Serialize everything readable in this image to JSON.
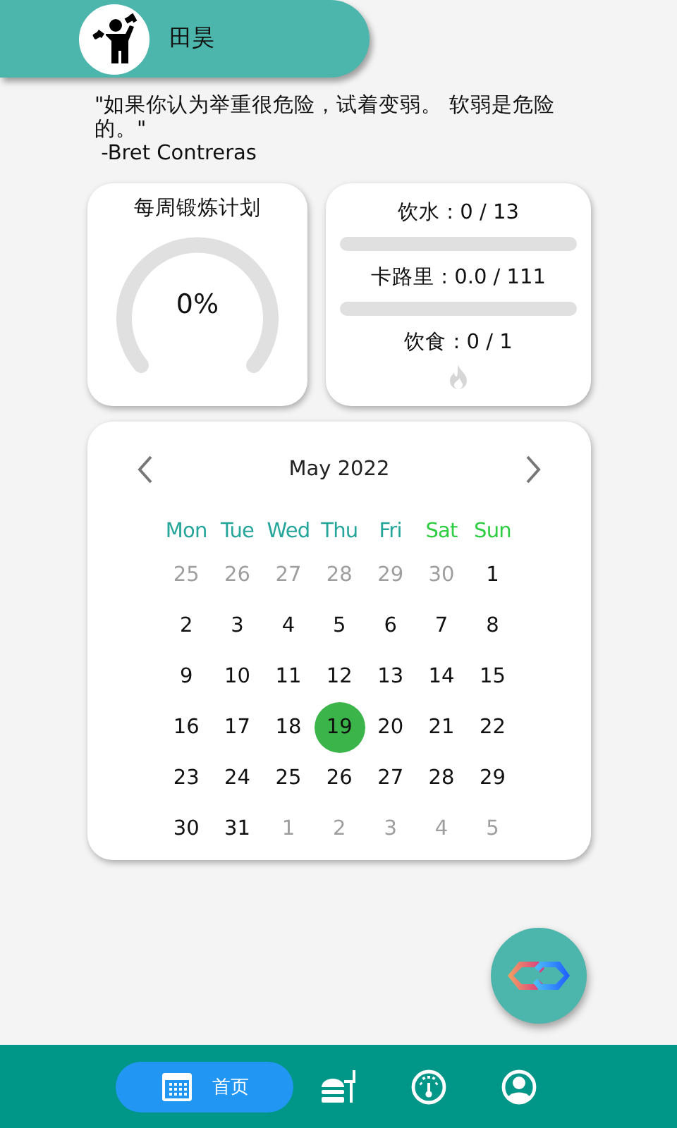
{
  "header": {
    "name": "田昊"
  },
  "quote": {
    "text": "\"如果你认为举重很危险，试着变弱。 软弱是危险的。\"",
    "author": " -Bret Contreras"
  },
  "weekly_plan": {
    "title": "每周锻炼计划",
    "reading": "0%"
  },
  "intake": [
    {
      "kind": "bar",
      "label": "饮水 : 0 / 13",
      "level": 0
    },
    {
      "kind": "bar",
      "label": "卡路里 : 0.0 / 111",
      "level": 0
    },
    {
      "kind": "flame",
      "label": "饮食 : 0 / 1"
    }
  ],
  "calendar": {
    "month": "May 2022",
    "weekdays": [
      {
        "label": "Mon",
        "color": "#26a69a"
      },
      {
        "label": "Tue",
        "color": "#26a69a"
      },
      {
        "label": "Wed",
        "color": "#26a69a"
      },
      {
        "label": "Thu",
        "color": "#26a69a"
      },
      {
        "label": "Fri",
        "color": "#26a69a"
      },
      {
        "label": "Sat",
        "color": "#2ecc40"
      },
      {
        "label": "Sun",
        "color": "#2ecc40"
      }
    ],
    "days": [
      {
        "label": "25",
        "in_month": false,
        "selected": false
      },
      {
        "label": "26",
        "in_month": false,
        "selected": false
      },
      {
        "label": "27",
        "in_month": false,
        "selected": false
      },
      {
        "label": "28",
        "in_month": false,
        "selected": false
      },
      {
        "label": "29",
        "in_month": false,
        "selected": false
      },
      {
        "label": "30",
        "in_month": false,
        "selected": false
      },
      {
        "label": "1",
        "in_month": true,
        "selected": false
      },
      {
        "label": "2",
        "in_month": true,
        "selected": false
      },
      {
        "label": "3",
        "in_month": true,
        "selected": false
      },
      {
        "label": "4",
        "in_month": true,
        "selected": false
      },
      {
        "label": "5",
        "in_month": true,
        "selected": false
      },
      {
        "label": "6",
        "in_month": true,
        "selected": false
      },
      {
        "label": "7",
        "in_month": true,
        "selected": false
      },
      {
        "label": "8",
        "in_month": true,
        "selected": false
      },
      {
        "label": "9",
        "in_month": true,
        "selected": false
      },
      {
        "label": "10",
        "in_month": true,
        "selected": false
      },
      {
        "label": "11",
        "in_month": true,
        "selected": false
      },
      {
        "label": "12",
        "in_month": true,
        "selected": false
      },
      {
        "label": "13",
        "in_month": true,
        "selected": false
      },
      {
        "label": "14",
        "in_month": true,
        "selected": false
      },
      {
        "label": "15",
        "in_month": true,
        "selected": false
      },
      {
        "label": "16",
        "in_month": true,
        "selected": false
      },
      {
        "label": "17",
        "in_month": true,
        "selected": false
      },
      {
        "label": "18",
        "in_month": true,
        "selected": false
      },
      {
        "label": "19",
        "in_month": true,
        "selected": true
      },
      {
        "label": "20",
        "in_month": true,
        "selected": false
      },
      {
        "label": "21",
        "in_month": true,
        "selected": false
      },
      {
        "label": "22",
        "in_month": true,
        "selected": false
      },
      {
        "label": "23",
        "in_month": true,
        "selected": false
      },
      {
        "label": "24",
        "in_month": true,
        "selected": false
      },
      {
        "label": "25",
        "in_month": true,
        "selected": false
      },
      {
        "label": "26",
        "in_month": true,
        "selected": false
      },
      {
        "label": "27",
        "in_month": true,
        "selected": false
      },
      {
        "label": "28",
        "in_month": true,
        "selected": false
      },
      {
        "label": "29",
        "in_month": true,
        "selected": false
      },
      {
        "label": "30",
        "in_month": true,
        "selected": false
      },
      {
        "label": "31",
        "in_month": true,
        "selected": false
      },
      {
        "label": "1",
        "in_month": false,
        "selected": false
      },
      {
        "label": "2",
        "in_month": false,
        "selected": false
      },
      {
        "label": "3",
        "in_month": false,
        "selected": false
      },
      {
        "label": "4",
        "in_month": false,
        "selected": false
      },
      {
        "label": "5",
        "in_month": false,
        "selected": false
      }
    ]
  },
  "nav": [
    {
      "kind": "home",
      "label": "首页",
      "selected": true
    },
    {
      "kind": "food",
      "selected": false
    },
    {
      "kind": "gauge",
      "selected": false
    },
    {
      "kind": "profile",
      "selected": false
    }
  ]
}
